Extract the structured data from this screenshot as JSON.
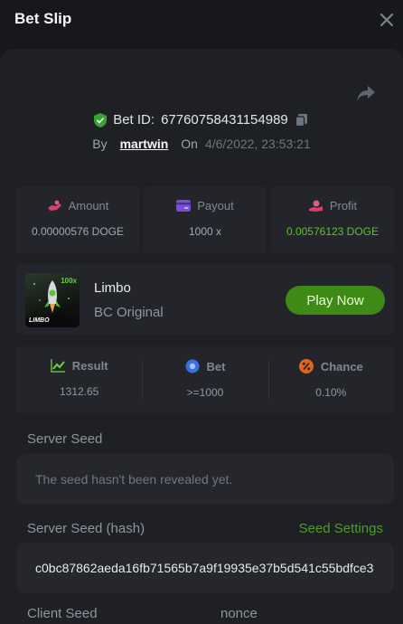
{
  "header": {
    "title": "Bet Slip"
  },
  "bet": {
    "id_label": "Bet ID:",
    "id": "67760758431154989",
    "by_label": "By",
    "user": "martwin",
    "on_label": "On",
    "date": "4/6/2022, 23:53:21"
  },
  "stats": {
    "amount_label": "Amount",
    "amount": "0.00000576 DOGE",
    "payout_label": "Payout",
    "payout": "1000 x",
    "profit_label": "Profit",
    "profit": "0.00576123 DOGE"
  },
  "game": {
    "name": "Limbo",
    "subtitle": "BC Original",
    "play_label": "Play Now",
    "thumb_text": "LIMBO",
    "thumb_badge": "100x"
  },
  "result": {
    "result_label": "Result",
    "result": "1312.65",
    "bet_label": "Bet",
    "bet": ">=1000",
    "chance_label": "Chance",
    "chance": "0.10%"
  },
  "seeds": {
    "server_label": "Server Seed",
    "server_value": "The seed hasn't been revealed yet.",
    "hash_label": "Server Seed (hash)",
    "settings_link": "Seed Settings",
    "hash_value": "c0bc87862aeda16fb71565b7a9f19935e37b5d541c55bdfce3",
    "client_label": "Client Seed",
    "nonce_label": "nonce"
  },
  "colors": {
    "accent_green": "#3f8a17",
    "profit_green": "#5fbf34",
    "panel": "#23252a",
    "background": "#17181b"
  }
}
